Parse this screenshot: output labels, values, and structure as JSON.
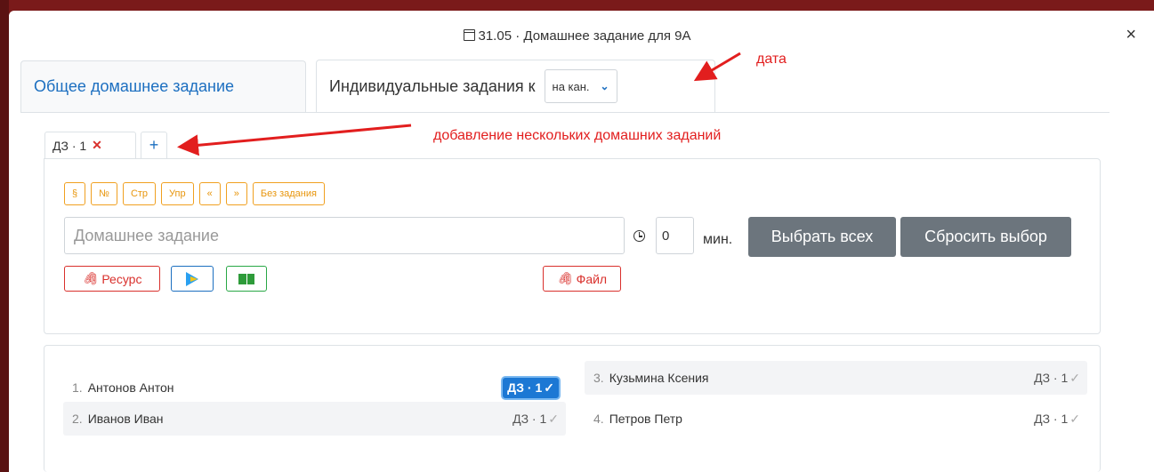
{
  "modal": {
    "title": "31.05 · Домашнее задание для 9А",
    "close_label": "×"
  },
  "tabs": {
    "general_label": "Общее домашнее задание",
    "individual_label": "Индивидуальные задания к",
    "date_select_value": "на кан."
  },
  "subtabs": {
    "hw1_label": "ДЗ · 1",
    "hw1_close": "✕",
    "add_label": "+"
  },
  "chips": [
    "§",
    "№",
    "Стр",
    "Упр",
    "«",
    "»",
    "Без задания"
  ],
  "homework": {
    "placeholder": "Домашнее задание",
    "minutes_value": "0",
    "minutes_label": "мин.",
    "select_all_label": "Выбрать всех",
    "reset_label": "Сбросить выбор"
  },
  "resources": {
    "resource_label": "Ресурс",
    "file_label": "Файл",
    "clip_glyph": "🖇"
  },
  "students": [
    {
      "num": "1.",
      "name": "Антонов Антон",
      "badge": "ДЗ · 1",
      "check": "✓"
    },
    {
      "num": "2.",
      "name": "Иванов Иван",
      "badge": "ДЗ · 1",
      "check": "✓"
    },
    {
      "num": "3.",
      "name": "Кузьмина Ксения",
      "badge": "ДЗ · 1",
      "check": "✓"
    },
    {
      "num": "4.",
      "name": "Петров Петр",
      "badge": "ДЗ · 1",
      "check": "✓"
    }
  ],
  "annotations": {
    "date": "дата",
    "multi": "добавление нескольких домашних заданий"
  },
  "colors": {
    "accent_blue": "#1c6fc0",
    "warning_orange": "#f0a020",
    "danger_red": "#d9302c",
    "annotation_red": "#e21e1e",
    "button_gray": "#6c757d"
  }
}
